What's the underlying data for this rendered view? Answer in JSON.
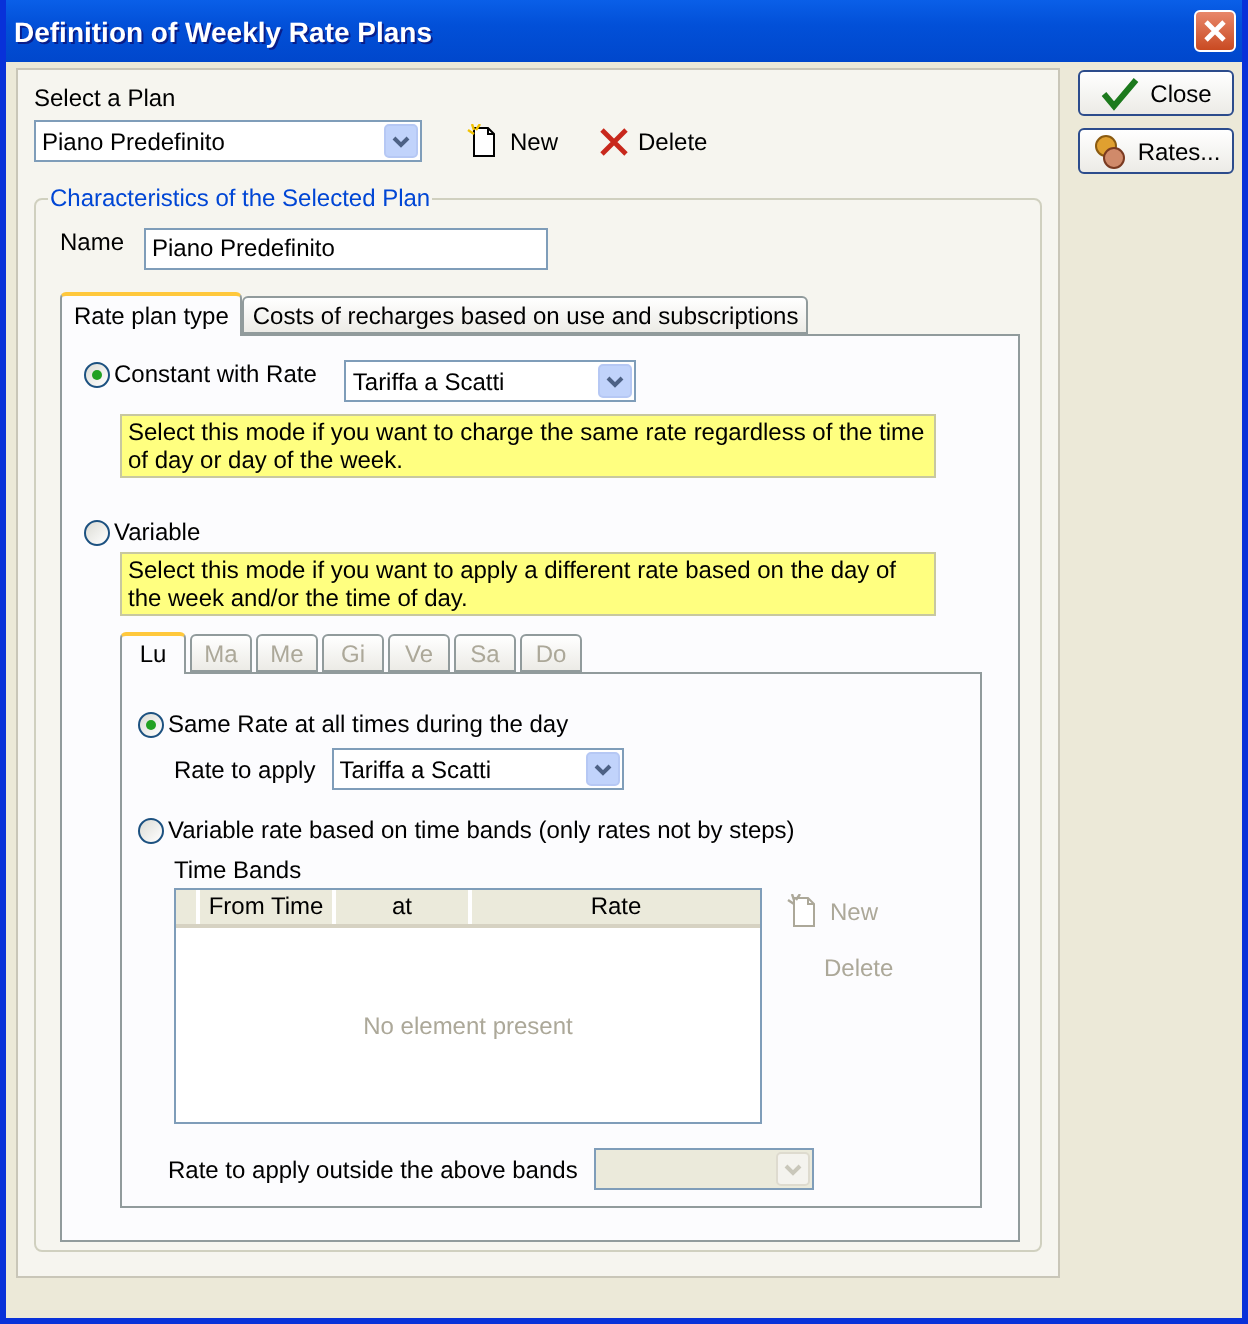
{
  "window": {
    "title": "Definition of Weekly Rate Plans"
  },
  "plan_selector": {
    "label": "Select a Plan",
    "value": "Piano Predefinito"
  },
  "plan_actions": [
    {
      "label": "New",
      "kind": "new"
    },
    {
      "label": "Delete",
      "kind": "delete"
    }
  ],
  "side_buttons": [
    {
      "label": "Close",
      "kind": "close"
    },
    {
      "label": "Rates...",
      "kind": "rates"
    }
  ],
  "characteristics": {
    "title": "Characteristics of the Selected Plan",
    "name_label": "Name",
    "name_value": "Piano Predefinito",
    "tabs": [
      {
        "label": "Rate plan type",
        "selected": true
      },
      {
        "label": "Costs of recharges based on use and subscriptions",
        "selected": false
      }
    ],
    "modes": [
      {
        "label": "Constant with Rate",
        "selected": true,
        "rate": "Tariffa a Scatti",
        "hint": "Select this mode if you want to charge the same rate regardless of the time of day or day of the week."
      },
      {
        "label": "Variable",
        "selected": false,
        "hint": "Select this mode if you want to apply a different rate based on the day of the week and/or the time of day."
      }
    ],
    "day_tabs": [
      {
        "label": "Lu",
        "selected": true,
        "disabled": false
      },
      {
        "label": "Ma",
        "selected": false,
        "disabled": true
      },
      {
        "label": "Me",
        "selected": false,
        "disabled": true
      },
      {
        "label": "Gi",
        "selected": false,
        "disabled": true
      },
      {
        "label": "Ve",
        "selected": false,
        "disabled": true
      },
      {
        "label": "Sa",
        "selected": false,
        "disabled": true
      },
      {
        "label": "Do",
        "selected": false,
        "disabled": true
      }
    ],
    "day_modes": [
      {
        "label": "Same Rate at all times during the day",
        "selected": true
      },
      {
        "label": "Variable rate based on time bands (only rates not by steps)",
        "selected": false
      }
    ],
    "rate_to_apply": {
      "label": "Rate to apply",
      "value": "Tariffa a Scatti"
    },
    "time_bands": {
      "title": "Time Bands",
      "columns": [
        "From Time",
        "at",
        "Rate"
      ],
      "empty_text": "No element present",
      "actions": [
        {
          "label": "New",
          "kind": "new",
          "disabled": true
        },
        {
          "label": "Delete",
          "kind": "delete",
          "disabled": true
        }
      ]
    },
    "outside_rate": {
      "label": "Rate to apply outside the above bands",
      "disabled": true
    }
  }
}
